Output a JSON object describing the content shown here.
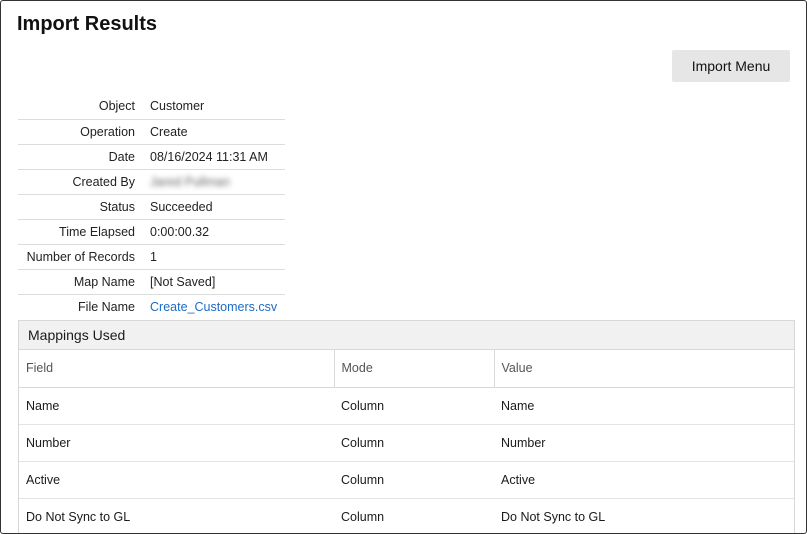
{
  "page": {
    "title": "Import Results"
  },
  "toolbar": {
    "import_menu_label": "Import Menu"
  },
  "details": [
    {
      "label": "Object",
      "value": "Customer"
    },
    {
      "label": "Operation",
      "value": "Create"
    },
    {
      "label": "Date",
      "value": "08/16/2024 11:31 AM"
    },
    {
      "label": "Created By",
      "value": "Jared Pullman"
    },
    {
      "label": "Status",
      "value": "Succeeded"
    },
    {
      "label": "Time Elapsed",
      "value": "0:00:00.32"
    },
    {
      "label": "Number of Records",
      "value": "1"
    },
    {
      "label": "Map Name",
      "value": "[Not Saved]"
    },
    {
      "label": "File Name",
      "value": "Create_Customers.csv"
    }
  ],
  "mappings": {
    "title": "Mappings Used",
    "columns": [
      "Field",
      "Mode",
      "Value"
    ],
    "rows": [
      [
        "Name",
        "Column",
        "Name"
      ],
      [
        "Number",
        "Column",
        "Number"
      ],
      [
        "Active",
        "Column",
        "Active"
      ],
      [
        "Do Not Sync to GL",
        "Column",
        "Do Not Sync to GL"
      ]
    ]
  },
  "colors": {
    "link": "#1f6bc5",
    "button_bg": "#e6e6e6",
    "section_header_bg": "#f1f1f1"
  }
}
